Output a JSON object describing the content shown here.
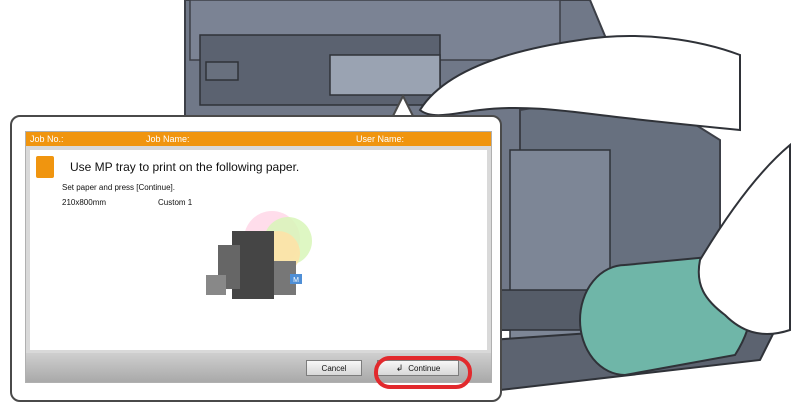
{
  "panel": {
    "header": {
      "job_no": "Job No.:",
      "job_name": "Job Name:",
      "user_name": "User Name:"
    },
    "message": {
      "title": "Use MP tray to print on the following paper.",
      "instruction": "Set paper and press [Continue].",
      "paper_size": "210x800mm",
      "paper_type": "Custom 1"
    },
    "buttons": {
      "cancel_label": "Cancel",
      "continue_label": "Continue",
      "continue_icon": "enter-key-icon"
    },
    "printer_illustration": {
      "badge": "M"
    }
  },
  "colors": {
    "header_orange": "#F0950F",
    "highlight_red": "#E2292D",
    "paper_roll_green": "#6FB6A8"
  }
}
